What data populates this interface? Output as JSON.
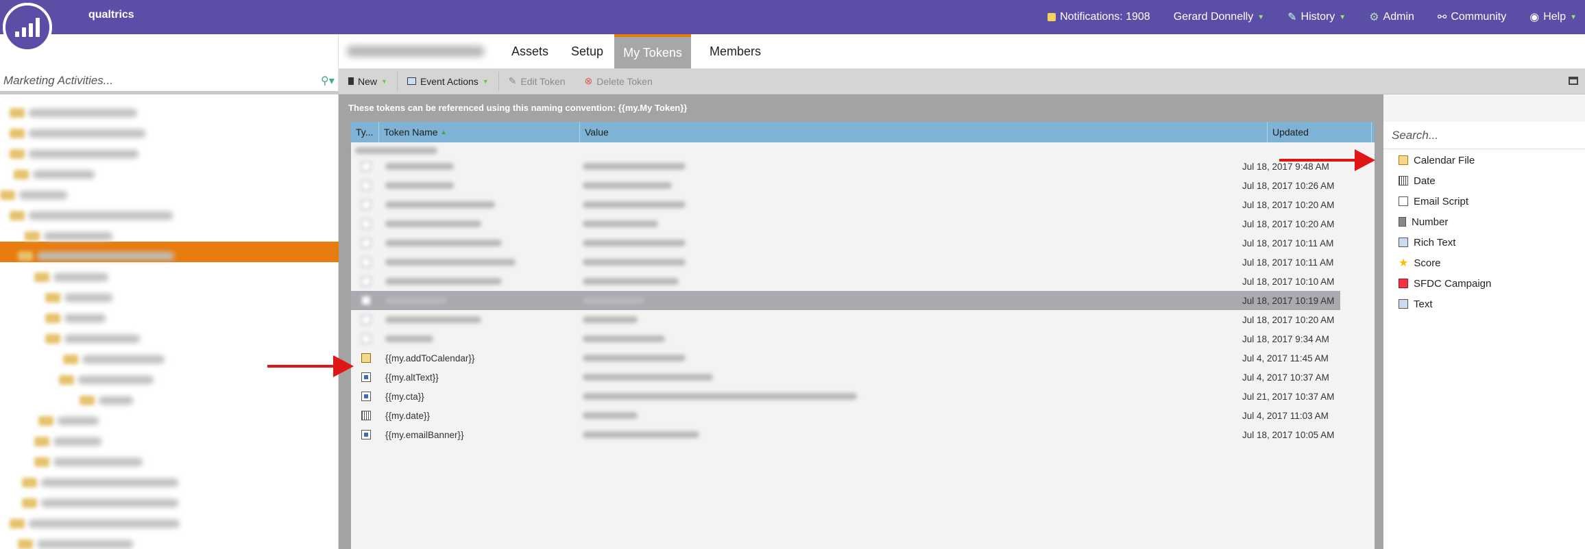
{
  "app": {
    "brand": "qualtrics"
  },
  "topnav": {
    "notifications": "Notifications: 1908",
    "user": "Gerard Donnelly",
    "history": "History",
    "admin": "Admin",
    "community": "Community",
    "help": "Help"
  },
  "tree": {
    "search_placeholder": "Marketing Activities..."
  },
  "tabs": [
    {
      "label": "Assets"
    },
    {
      "label": "Setup"
    },
    {
      "label": "My Tokens",
      "active": true
    },
    {
      "label": "Members"
    }
  ],
  "toolbar": {
    "new": "New",
    "event_actions": "Event Actions",
    "edit_token": "Edit Token",
    "delete_token": "Delete Token"
  },
  "hint": "These tokens can be referenced using this naming convention: {{my.My Token}}",
  "grid": {
    "columns": [
      "Ty...",
      "Token Name",
      "Value",
      "Updated"
    ],
    "rows": [
      {
        "name": "",
        "updated": "Jul 18, 2017 9:48 AM"
      },
      {
        "name": "",
        "updated": "Jul 18, 2017 10:26 AM"
      },
      {
        "name": "",
        "updated": "Jul 18, 2017 10:20 AM"
      },
      {
        "name": "",
        "updated": "Jul 18, 2017 10:20 AM"
      },
      {
        "name": "",
        "updated": "Jul 18, 2017 10:11 AM"
      },
      {
        "name": "",
        "updated": "Jul 18, 2017 10:11 AM"
      },
      {
        "name": "",
        "updated": "Jul 18, 2017 10:10 AM"
      },
      {
        "name": "",
        "updated": "Jul 18, 2017 10:19 AM",
        "selected": true
      },
      {
        "name": "",
        "updated": "Jul 18, 2017 10:20 AM"
      },
      {
        "name": "",
        "updated": "Jul 18, 2017 9:34 AM"
      },
      {
        "name": "{{my.addToCalendar}}",
        "updated": "Jul 4, 2017 11:45 AM",
        "icon": "calendar-file-icon"
      },
      {
        "name": "{{my.altText}}",
        "updated": "Jul 4, 2017 10:37 AM",
        "icon": "text-icon"
      },
      {
        "name": "{{my.cta}}",
        "updated": "Jul 21, 2017 10:37 AM",
        "icon": "text-icon"
      },
      {
        "name": "{{my.date}}",
        "updated": "Jul 4, 2017 11:03 AM",
        "icon": "date-icon"
      },
      {
        "name": "{{my.emailBanner}}",
        "updated": "Jul 18, 2017 10:05 AM",
        "icon": "text-icon"
      }
    ]
  },
  "token_types": {
    "search_placeholder": "Search...",
    "items": [
      "Calendar File",
      "Date",
      "Email Script",
      "Number",
      "Rich Text",
      "Score",
      "SFDC Campaign",
      "Text"
    ]
  },
  "colors": {
    "brand": "#5b4ea6",
    "accent": "#e97c0f",
    "grid_header": "#7fb3d5",
    "arrow": "#e01616"
  }
}
